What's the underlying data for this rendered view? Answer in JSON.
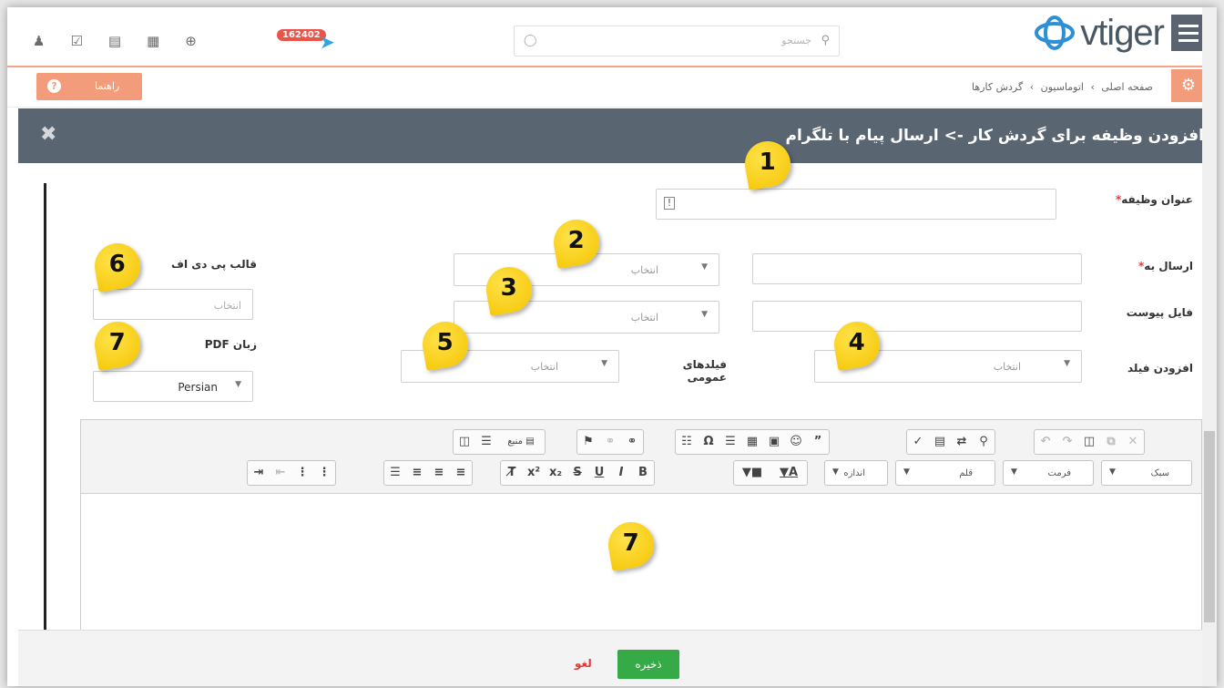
{
  "header": {
    "logo_text": "vtiger",
    "search_placeholder": "جستجو",
    "notification_count": "162402"
  },
  "breadcrumb": {
    "items": [
      "صفحه اصلی",
      "اتوماسیون",
      "گردش کارها"
    ],
    "separator": "›"
  },
  "help_button": {
    "label": "راهنما",
    "icon": "?"
  },
  "modal": {
    "title": "افزودن وظیفه برای گردش کار -> ارسال پیام با تلگرام",
    "close": "✖",
    "fields": {
      "task_title_label": "عنوان وظیفه",
      "required_mark": "*",
      "send_to_label": "ارسال به",
      "send_to_select": "انتخاب",
      "attachment_label": "فایل پیوست",
      "attachment_select": "انتخاب",
      "add_field_label": "افزودن فیلد",
      "add_field_select": "انتخاب",
      "general_fields_label": "فیلدهای عمومی",
      "general_fields_select": "انتخاب",
      "pdf_template_label": "قالب پی دی اف",
      "pdf_template_placeholder": "انتخاب",
      "pdf_language_label": "زبان PDF",
      "pdf_language_value": "Persian"
    },
    "editor": {
      "row1_source": "منبع",
      "combo_style": "سبک",
      "combo_format": "فرمت",
      "combo_font": "قلم",
      "combo_size": "اندازه"
    },
    "callouts": [
      "1",
      "2",
      "3",
      "4",
      "5",
      "6",
      "7",
      "7"
    ]
  },
  "footer": {
    "save_label": "ذخیره",
    "cancel_label": "لغو"
  },
  "colors": {
    "accent": "#f29c7b",
    "header": "#596672",
    "save": "#35aa47",
    "callout": "#f4c400"
  }
}
